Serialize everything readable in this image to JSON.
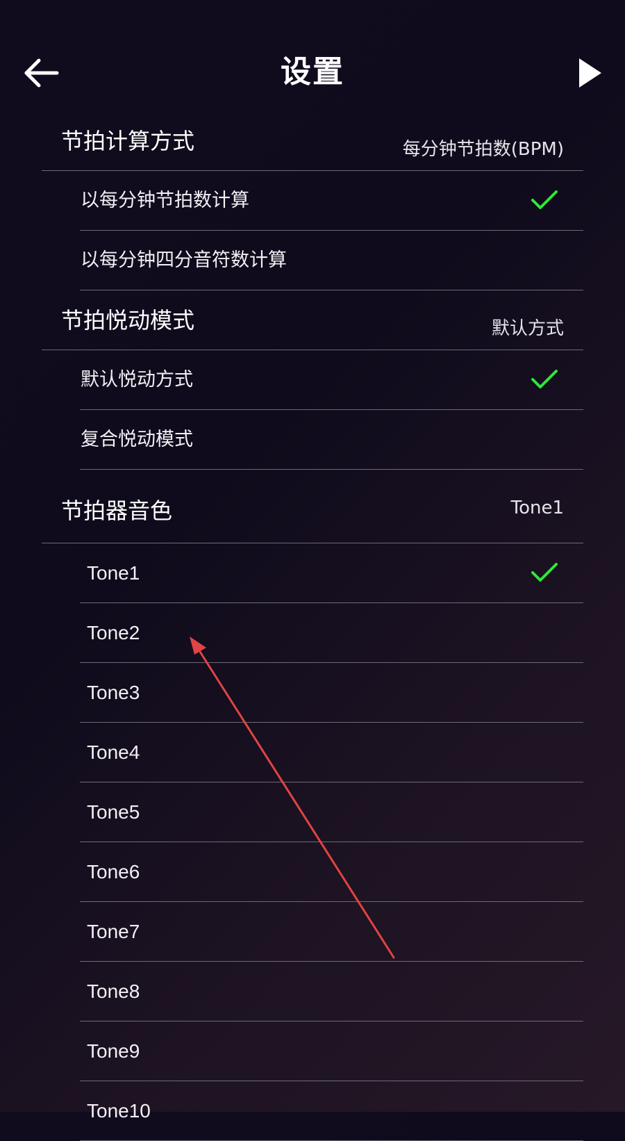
{
  "header": {
    "title": "设置",
    "back_icon": "arrow-left-icon",
    "play_icon": "play-icon"
  },
  "sections": [
    {
      "key": "beat-calc",
      "label": "节拍计算方式",
      "value": "每分钟节拍数(BPM)",
      "options": [
        {
          "label": "以每分钟节拍数计算",
          "selected": true
        },
        {
          "label": "以每分钟四分音符数计算",
          "selected": false
        }
      ]
    },
    {
      "key": "beat-pulse",
      "label": "节拍悦动模式",
      "value": "默认方式",
      "options": [
        {
          "label": "默认悦动方式",
          "selected": true
        },
        {
          "label": "复合悦动模式",
          "selected": false
        }
      ]
    },
    {
      "key": "metronome-tone",
      "label": "节拍器音色",
      "value": "Tone1",
      "options": [
        {
          "label": "Tone1",
          "selected": true
        },
        {
          "label": "Tone2",
          "selected": false
        },
        {
          "label": "Tone3",
          "selected": false
        },
        {
          "label": "Tone4",
          "selected": false
        },
        {
          "label": "Tone5",
          "selected": false
        },
        {
          "label": "Tone6",
          "selected": false
        },
        {
          "label": "Tone7",
          "selected": false
        },
        {
          "label": "Tone8",
          "selected": false
        },
        {
          "label": "Tone9",
          "selected": false
        },
        {
          "label": "Tone10",
          "selected": false
        }
      ]
    }
  ],
  "colors": {
    "check": "#2ee83a",
    "divider": "#6f6a78",
    "annotation_arrow": "#e04444"
  },
  "icons": {
    "selected": "checkmark-icon"
  }
}
